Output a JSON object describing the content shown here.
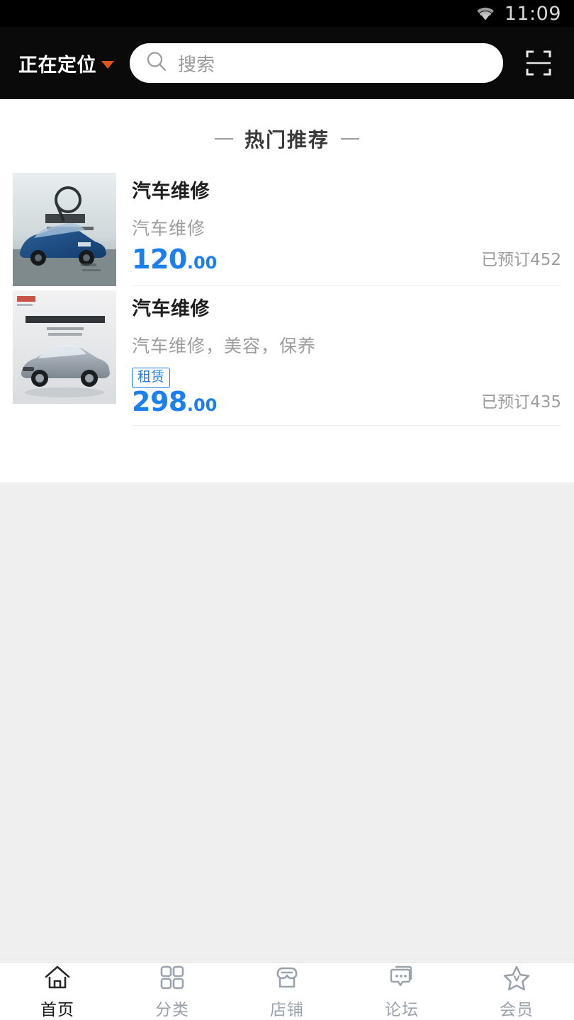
{
  "status_bar": {
    "time": "11:09",
    "wifi_icon": "wifi-icon"
  },
  "app_bar": {
    "location_label": "正在定位",
    "location_chevron_icon": "chevron-down-icon",
    "location_chevron_color": "#e2541f",
    "search_placeholder": "搜索",
    "search_icon": "search-icon",
    "scan_icon": "scan-qr-icon"
  },
  "section": {
    "title": "热门推荐",
    "left_dash": "—",
    "right_dash": "—"
  },
  "products": [
    {
      "title": "汽车维修",
      "subtitle": "汽车维修",
      "tag": null,
      "price_int": "120",
      "price_dec": ".00",
      "booked": "已预订452",
      "thumb_name": "product-image-blue-sedan",
      "thumb_caption": "历而新"
    },
    {
      "title": "汽车维修",
      "subtitle": "汽车维修，美容，保养",
      "tag": "租赁",
      "price_int": "298",
      "price_dec": ".00",
      "booked": "已预订435",
      "thumb_name": "product-image-silver-sedan",
      "thumb_caption": "东风风神南京地区L60上市会"
    }
  ],
  "tabs": [
    {
      "label": "首页",
      "icon": "home-icon",
      "active": true
    },
    {
      "label": "分类",
      "icon": "grid-icon",
      "active": false
    },
    {
      "label": "店铺",
      "icon": "shop-icon",
      "active": false
    },
    {
      "label": "论坛",
      "icon": "chat-icon",
      "active": false
    },
    {
      "label": "会员",
      "icon": "star-icon",
      "active": false
    }
  ],
  "colors": {
    "accent_blue": "#1b7ff0",
    "accent_orange": "#e2541f",
    "tab_inactive": "#9aa3ac",
    "page_bg": "#efefef"
  }
}
